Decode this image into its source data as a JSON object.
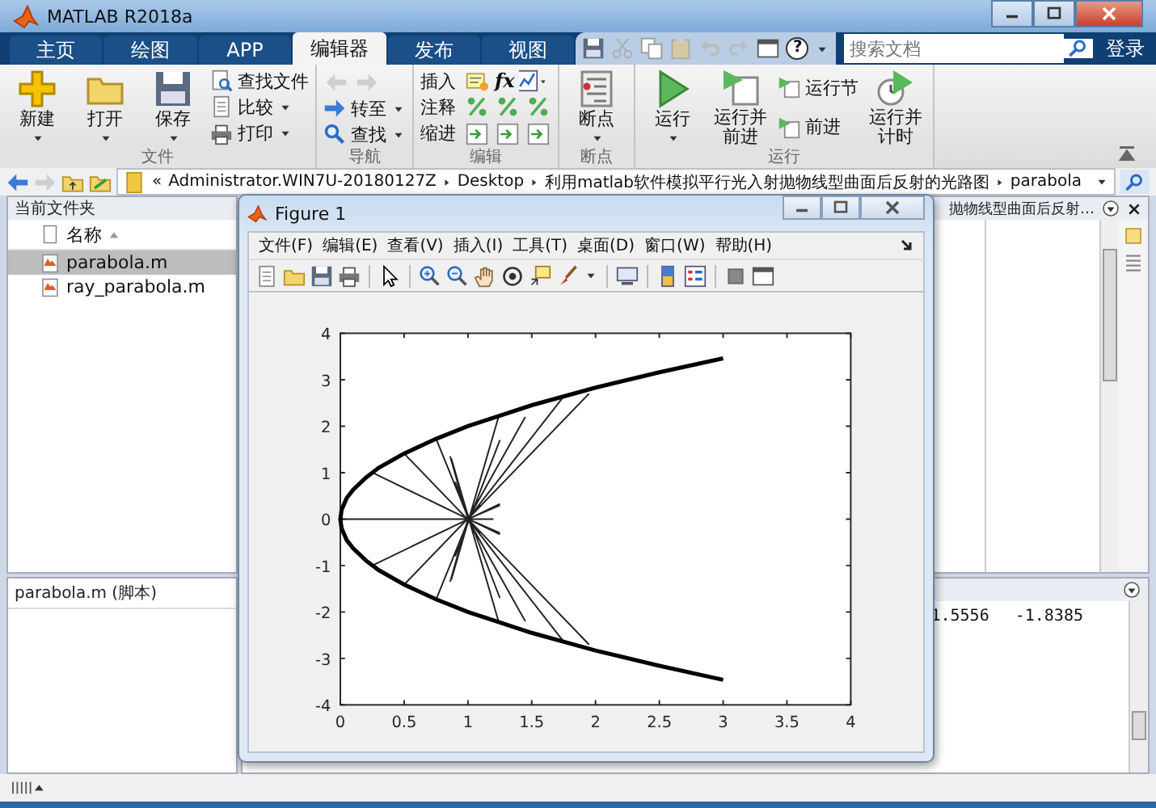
{
  "window": {
    "title": "MATLAB R2018a"
  },
  "tabs": [
    {
      "label": "主页",
      "selected": false
    },
    {
      "label": "绘图",
      "selected": false
    },
    {
      "label": "APP",
      "selected": false
    },
    {
      "label": "编辑器",
      "selected": true
    },
    {
      "label": "发布",
      "selected": false
    },
    {
      "label": "视图",
      "selected": false
    }
  ],
  "search": {
    "placeholder": "搜索文档"
  },
  "help_button": "?",
  "login_button": "登录",
  "toolstrip": {
    "groups": [
      {
        "label": "文件",
        "columns": [
          [
            [
              {
                "kind": "large",
                "label": "新建",
                "dropdown": true
              }
            ]
          ],
          [
            [
              {
                "kind": "large",
                "label": "打开",
                "dropdown": true
              }
            ]
          ],
          [
            [
              {
                "kind": "large",
                "label": "保存",
                "dropdown": true
              }
            ]
          ],
          [
            [
              {
                "kind": "small",
                "label": "查找文件",
                "dropdown": false
              }
            ],
            [
              {
                "kind": "small",
                "label": "比较",
                "dropdown": true
              }
            ],
            [
              {
                "kind": "small",
                "label": "打印",
                "dropdown": true
              }
            ]
          ]
        ]
      },
      {
        "label": "导航",
        "columns": [
          [
            [
              {
                "kind": "icon",
                "dropdown": false
              },
              {
                "kind": "icon",
                "dropdown": false
              }
            ],
            [
              {
                "kind": "small",
                "label": "转至",
                "dropdown": true
              }
            ],
            [
              {
                "kind": "small",
                "label": "查找",
                "dropdown": true
              }
            ]
          ]
        ]
      },
      {
        "label": "编辑",
        "columns": [
          [
            [
              {
                "kind": "text",
                "label": "插入",
                "dropdown": false
              },
              {
                "kind": "icon",
                "dropdown": false
              },
              {
                "kind": "glyph",
                "label": "fx",
                "dropdown": false
              },
              {
                "kind": "icon",
                "dropdown": true
              }
            ],
            [
              {
                "kind": "text",
                "label": "注释",
                "dropdown": false
              },
              {
                "kind": "icon",
                "dropdown": false
              },
              {
                "kind": "icon",
                "dropdown": false
              },
              {
                "kind": "icon",
                "dropdown": false
              }
            ],
            [
              {
                "kind": "text",
                "label": "缩进",
                "dropdown": false
              },
              {
                "kind": "icon",
                "dropdown": false
              },
              {
                "kind": "icon",
                "dropdown": false
              },
              {
                "kind": "icon",
                "dropdown": false
              }
            ]
          ]
        ]
      },
      {
        "label": "断点",
        "columns": [
          [
            [
              {
                "kind": "large",
                "label": "断点",
                "dropdown": true
              }
            ]
          ]
        ]
      },
      {
        "label": "运行",
        "columns": [
          [
            [
              {
                "kind": "large",
                "label": "运行",
                "dropdown": true
              }
            ]
          ],
          [
            [
              {
                "kind": "large",
                "label": "运行并前进",
                "dropdown": false
              }
            ]
          ],
          [
            [
              {
                "kind": "small",
                "label": "运行节",
                "dropdown": false
              }
            ],
            [
              {
                "kind": "small",
                "label": "前进",
                "dropdown": false
              }
            ]
          ],
          [
            [
              {
                "kind": "large",
                "label": "运行并计时",
                "dropdown": false
              }
            ]
          ]
        ]
      }
    ]
  },
  "path_bar": {
    "overflow": "«",
    "crumbs": [
      "Administrator.WIN7U-20180127Z",
      "Desktop",
      "利用matlab软件模拟平行光入射抛物线型曲面后反射的光路图",
      "parabola"
    ]
  },
  "current_folder": {
    "title": "当前文件夹",
    "column": "名称",
    "files": [
      {
        "name": "parabola.m",
        "selected": true
      },
      {
        "name": "ray_parabola.m",
        "selected": false
      }
    ]
  },
  "details": {
    "title": "parabola.m  (脚本)"
  },
  "editor": {
    "title": "抛物线型曲面后反射…"
  },
  "command_window": {
    "output": [
      "1.5556",
      "-1.8385"
    ]
  },
  "figure": {
    "title": "Figure 1",
    "menu": [
      "文件(F)",
      "编辑(E)",
      "查看(V)",
      "插入(I)",
      "工具(T)",
      "桌面(D)",
      "窗口(W)",
      "帮助(H)"
    ],
    "chart_data": {
      "type": "line",
      "x": [
        3,
        2.5,
        2,
        1.5,
        1,
        0.75,
        0.5,
        0.3,
        0.2,
        0.1,
        0.05,
        0.01,
        0,
        0.01,
        0.05,
        0.1,
        0.2,
        0.3,
        0.5,
        0.75,
        1,
        1.5,
        2,
        2.5,
        3
      ],
      "series": [
        {
          "color": "#000000",
          "values": [
            -3.46,
            -3.16,
            -2.83,
            -2.45,
            -2,
            -1.73,
            -1.41,
            -1.1,
            -0.89,
            -0.63,
            -0.45,
            -0.2,
            0,
            0.2,
            0.45,
            0.63,
            0.89,
            1.1,
            1.41,
            1.73,
            2,
            2.45,
            2.83,
            3.16,
            3.46
          ]
        }
      ],
      "xlim": [
        0,
        4
      ],
      "ylim": [
        -4,
        4
      ],
      "xticks": [
        0,
        0.5,
        1,
        1.5,
        2,
        2.5,
        3,
        3.5,
        4
      ],
      "yticks": [
        -4,
        -3,
        -2,
        -1,
        0,
        1,
        2,
        3,
        4
      ]
    }
  }
}
